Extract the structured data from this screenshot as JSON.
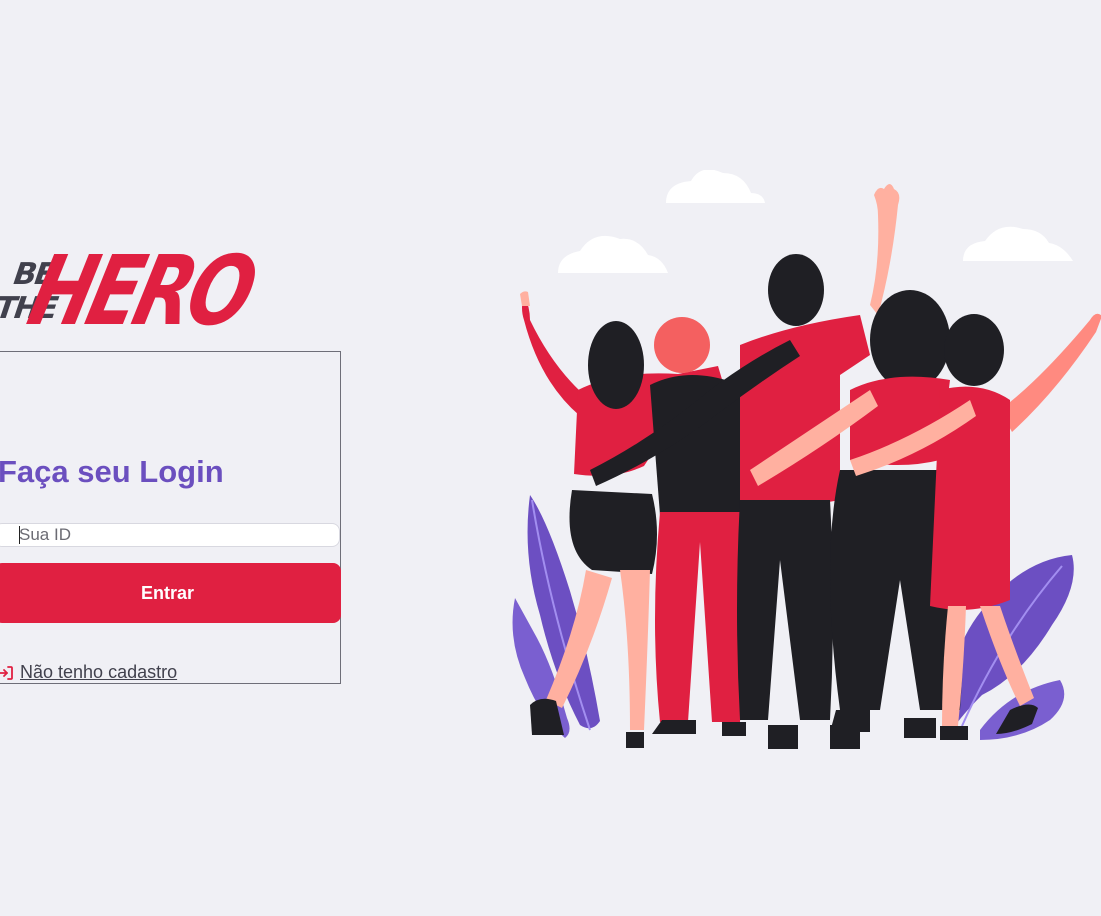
{
  "logo": {
    "line1": "BE",
    "line2": "THE",
    "brand": "HERO"
  },
  "login": {
    "title": "Faça seu Login",
    "id_placeholder": "Sua ID",
    "id_value": "",
    "submit_label": "Entrar",
    "register_link_label": "Não tenho cadastro"
  },
  "colors": {
    "background": "#f0f0f5",
    "brand_red": "#e02041",
    "title_purple": "#6b4fbf",
    "text_dark": "#41414d"
  },
  "icons": {
    "register_link_icon": "log-in-arrow-icon"
  }
}
